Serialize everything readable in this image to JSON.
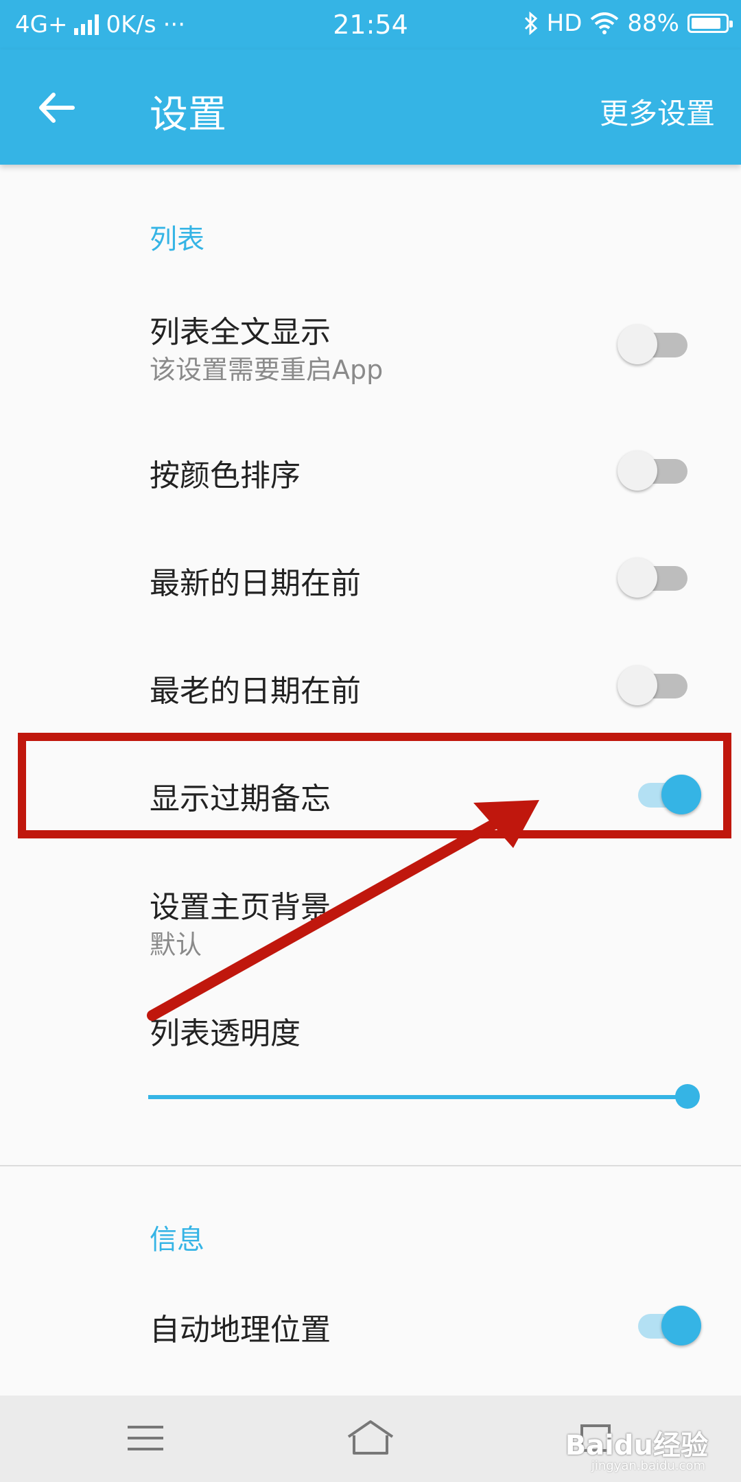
{
  "status_bar": {
    "network": "4G+",
    "speed": "0K/s",
    "dots": "···",
    "time": "21:54",
    "hd": "HD",
    "battery": "88%",
    "battery_level": 0.88
  },
  "toolbar": {
    "title": "设置",
    "more_label": "更多设置"
  },
  "sections": {
    "list": {
      "header": "列表"
    },
    "info": {
      "header": "信息"
    }
  },
  "rows": {
    "full_text": {
      "title": "列表全文显示",
      "subtitle": "该设置需要重启App",
      "enabled": false
    },
    "sort_by_color": {
      "title": "按颜色排序",
      "enabled": false
    },
    "newest_first": {
      "title": "最新的日期在前",
      "enabled": false
    },
    "oldest_first": {
      "title": "最老的日期在前",
      "enabled": false
    },
    "show_expired": {
      "title": "显示过期备忘",
      "enabled": true
    },
    "home_bg": {
      "title": "设置主页背景",
      "value": "默认"
    },
    "transparency": {
      "title": "列表透明度",
      "level": 1.0
    },
    "auto_location": {
      "title": "自动地理位置",
      "enabled": true
    }
  },
  "annotation": {
    "color": "#c0170d"
  },
  "navbar": {
    "watermark": "Baidu经验",
    "watermark_sub": "jingyan.baidu.com"
  },
  "colors": {
    "accent": "#35b4e5",
    "background": "#fafafa"
  }
}
